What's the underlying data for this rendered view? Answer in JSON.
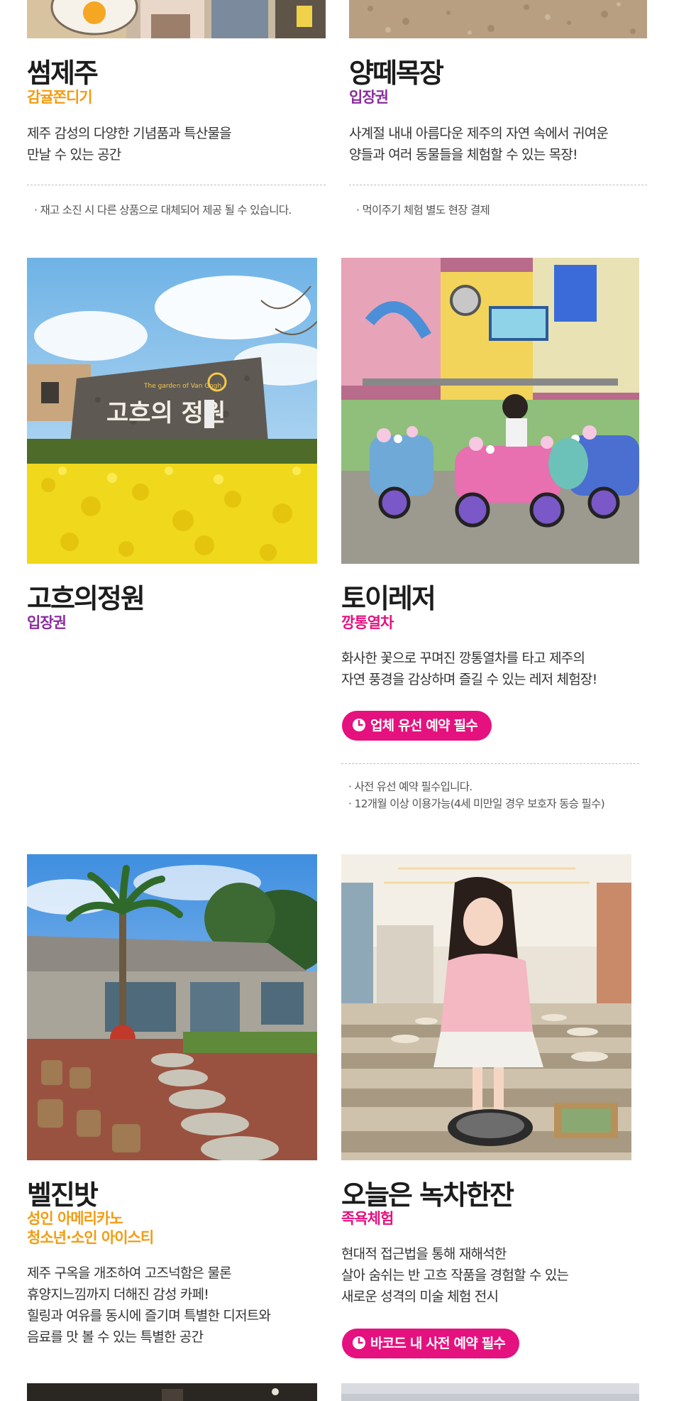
{
  "colors": {
    "orange_accent": "#f29c12",
    "purple_accent": "#8b2c9e",
    "pink_accent": "#e5117e",
    "text_dark": "#1c1c1c",
    "text_body": "#333333",
    "text_note": "#555555"
  },
  "cards": [
    {
      "title": "썸제주",
      "subtitle": "감귤쫀디기",
      "subtitle_color": "orange",
      "description": [
        "제주 감성의 다양한 기념품과 특산물을",
        "만날 수 있는 공간"
      ],
      "notes": [
        "· 재고 소진 시 다른 상품으로 대체되어 제공 될 수 있습니다."
      ]
    },
    {
      "title": "양떼목장",
      "subtitle": "입장권",
      "subtitle_color": "purple",
      "description": [
        "사계절 내내 아름다운 제주의 자연 속에서 귀여운",
        "양들과 여러 동물들을 체험할 수 있는 목장!"
      ],
      "notes": [
        "· 먹이주기 체험 별도 현장 결제"
      ]
    },
    {
      "title": "고흐의정원",
      "subtitle": "입장권",
      "subtitle_color": "purple",
      "photo_icon": "garden-photo",
      "sign_text": "고흐의 정원",
      "sign_caption": "The garden of Van Gogh"
    },
    {
      "title": "토이레저",
      "subtitle": "깡통열차",
      "subtitle_color": "pink",
      "photo_icon": "toy-train-photo",
      "description": [
        "화사한 꽃으로 꾸며진 깡통열차를 타고 제주의",
        "자연 풍경을 감상하며 즐길 수 있는 레저 체험장!"
      ],
      "pill_label": "업체 유선 예약 필수",
      "notes": [
        "· 사전 유선 예약 필수입니다.",
        "· 12개월 이상 이용가능(4세 미만일 경우 보호자 동승 필수)"
      ]
    },
    {
      "title": "벨진밧",
      "subtitle_lines": [
        "성인 아메리카노",
        "청소년·소인 아이스티"
      ],
      "subtitle_color": "orange",
      "photo_icon": "cafe-garden-photo",
      "description": [
        "제주 구옥을 개조하여 고즈넉함은 물론",
        "휴양지느낌까지 더해진 감성 카페!",
        "힐링과 여유를 동시에 즐기며 특별한 디저트와",
        "음료를 맛 볼 수 있는 특별한 공간"
      ]
    },
    {
      "title": "오늘은 녹차한잔",
      "subtitle": "족욕체험",
      "subtitle_color": "pink",
      "photo_icon": "footbath-photo",
      "description": [
        "현대적 접근법을 통해 재해석한",
        "살아 숨쉬는 반 고흐 작품을 경험할 수 있는",
        "새로운 성격의 미술 체험 전시"
      ],
      "pill_label": "바코드 내 사전 예약 필수"
    }
  ]
}
